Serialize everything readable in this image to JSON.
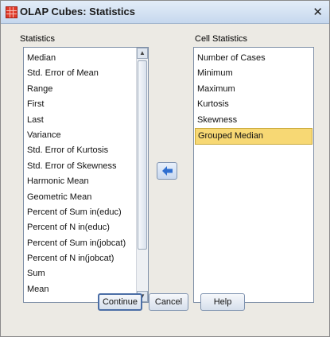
{
  "window": {
    "title": "OLAP Cubes: Statistics",
    "close_glyph": "✕"
  },
  "statistics": {
    "label": "Statistics",
    "items": [
      "Median",
      "Std. Error of Mean",
      "Range",
      "First",
      "Last",
      "Variance",
      "Std. Error of Kurtosis",
      "Std. Error of Skewness",
      "Harmonic Mean",
      "Geometric Mean",
      "Percent of Sum in(educ)",
      "Percent of N in(educ)",
      "Percent of Sum in(jobcat)",
      "Percent of N in(jobcat)",
      "Sum",
      "Mean"
    ]
  },
  "cell_statistics": {
    "label": "Cell Statistics",
    "items": [
      "Number of Cases",
      "Minimum",
      "Maximum",
      "Kurtosis",
      "Skewness",
      "Grouped Median"
    ],
    "selected": "Grouped Median"
  },
  "move_button": {
    "icon": "arrow-left-icon"
  },
  "buttons": {
    "continue": "Continue",
    "cancel": "Cancel",
    "help": "Help"
  },
  "colors": {
    "selection": "#f7d874",
    "list_border": "#7d8ea6",
    "dialog_bg": "#eceae4"
  }
}
